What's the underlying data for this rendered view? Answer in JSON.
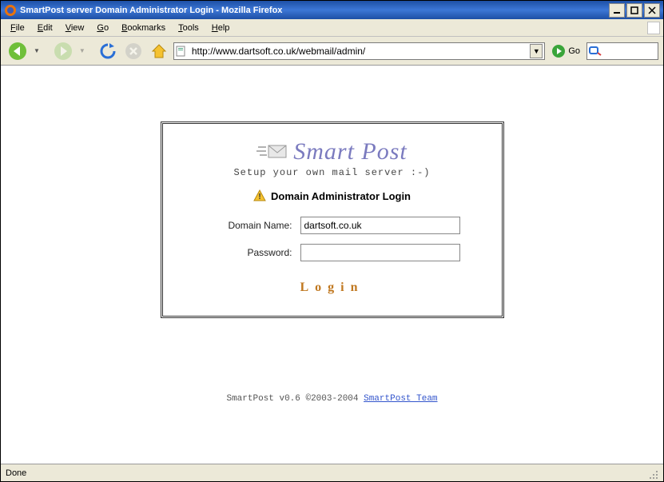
{
  "window": {
    "title": "SmartPost server Domain Administrator Login - Mozilla Firefox"
  },
  "menu": {
    "items": [
      "File",
      "Edit",
      "View",
      "Go",
      "Bookmarks",
      "Tools",
      "Help"
    ]
  },
  "toolbar": {
    "url": "http://www.dartsoft.co.uk/webmail/admin/",
    "go_label": "Go"
  },
  "page": {
    "logo_text": "Smart Post",
    "tagline": "Setup your own mail server :-)",
    "section_title": "Domain Administrator Login",
    "domain_label": "Domain Name:",
    "domain_value": "dartsoft.co.uk",
    "password_label": "Password:",
    "password_value": "",
    "login_button": "Login",
    "footer_prefix": "SmartPost v0.6 ©2003-2004 ",
    "footer_link": "SmartPost Team"
  },
  "status": {
    "text": "Done"
  }
}
